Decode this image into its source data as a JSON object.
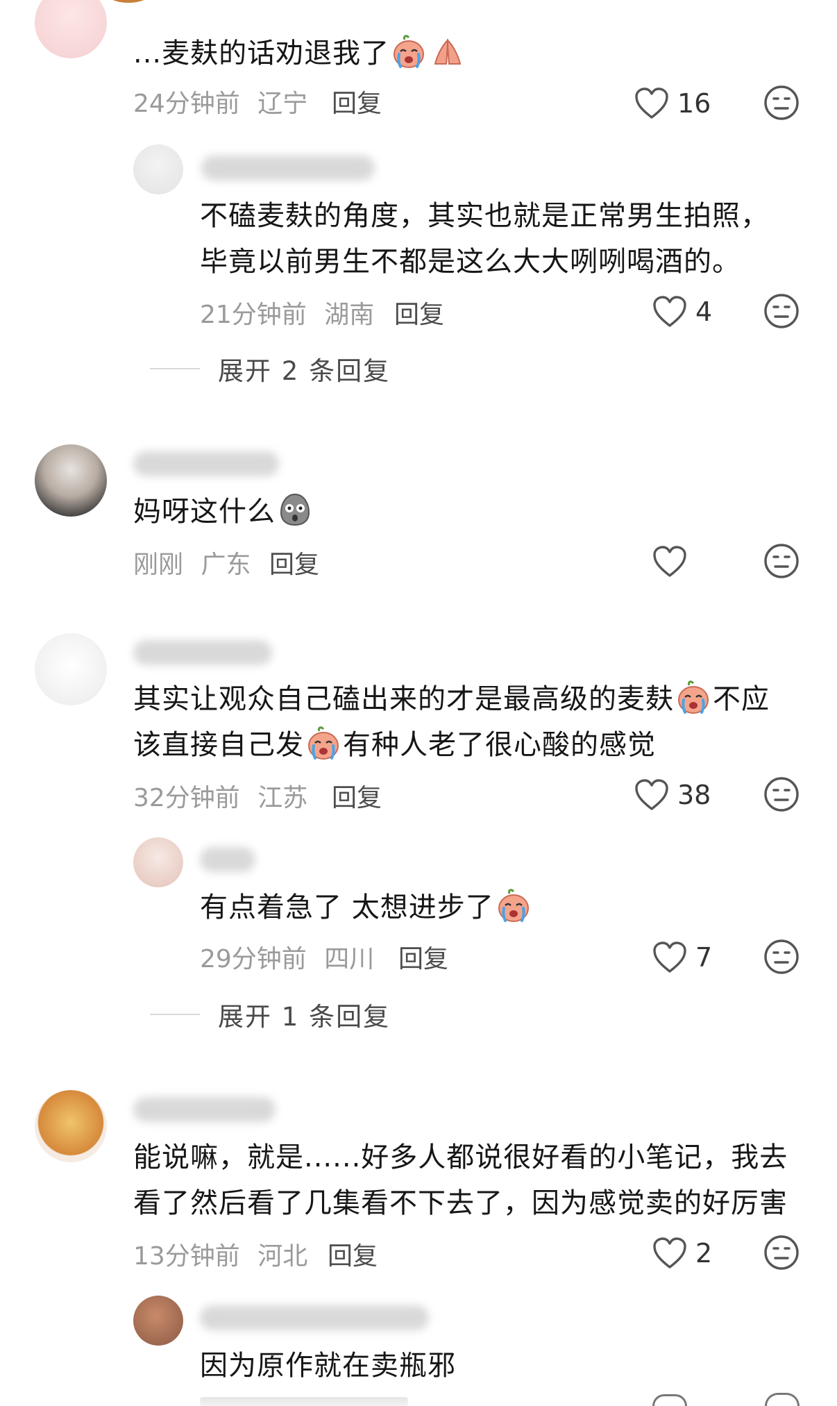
{
  "comments": [
    {
      "text": "...麦麸的话劝退我了",
      "time": "24分钟前",
      "location": "辽宁",
      "reply": "回复",
      "likes": "16",
      "emojis": [
        "crying-face-emoji",
        "praying-hands-emoji"
      ],
      "replies": [
        {
          "line1": "不磕麦麸的角度，其实也就是正常男生拍照，",
          "line2": "毕竟以前男生不都是这么大大咧咧喝酒的。",
          "time": "21分钟前",
          "location": "湖南",
          "reply": "回复",
          "likes": "4"
        }
      ],
      "expand": "展开 2 条回复"
    },
    {
      "text": "妈呀这什么",
      "time": "刚刚",
      "location": "广东",
      "reply": "回复",
      "likes": "",
      "emojis": [
        "shocked-face-emoji"
      ]
    },
    {
      "line1a": "其实让观众自己磕出来的才是最高级的麦麸",
      "line1b": "不应",
      "line2a": "该直接自己发",
      "line2b": "有种人老了很心酸的感觉",
      "time": "32分钟前",
      "location": "江苏",
      "reply": "回复",
      "likes": "38",
      "replies": [
        {
          "text": "有点着急了 太想进步了",
          "time": "29分钟前",
          "location": "四川",
          "reply": "回复",
          "likes": "7"
        }
      ],
      "expand": "展开 1 条回复"
    },
    {
      "line1": "能说嘛，就是......好多人都说很好看的小笔记，我去",
      "line2": "看了然后看了几集看不下去了，因为感觉卖的好厉害",
      "time": "13分钟前",
      "location": "河北",
      "reply": "回复",
      "likes": "2",
      "replies": [
        {
          "text": "因为原作就在卖瓶邪"
        }
      ]
    }
  ],
  "colors": {
    "meta": "#9a9a9a",
    "icon": "#555555",
    "emoji_peach": "#f2a08a"
  }
}
